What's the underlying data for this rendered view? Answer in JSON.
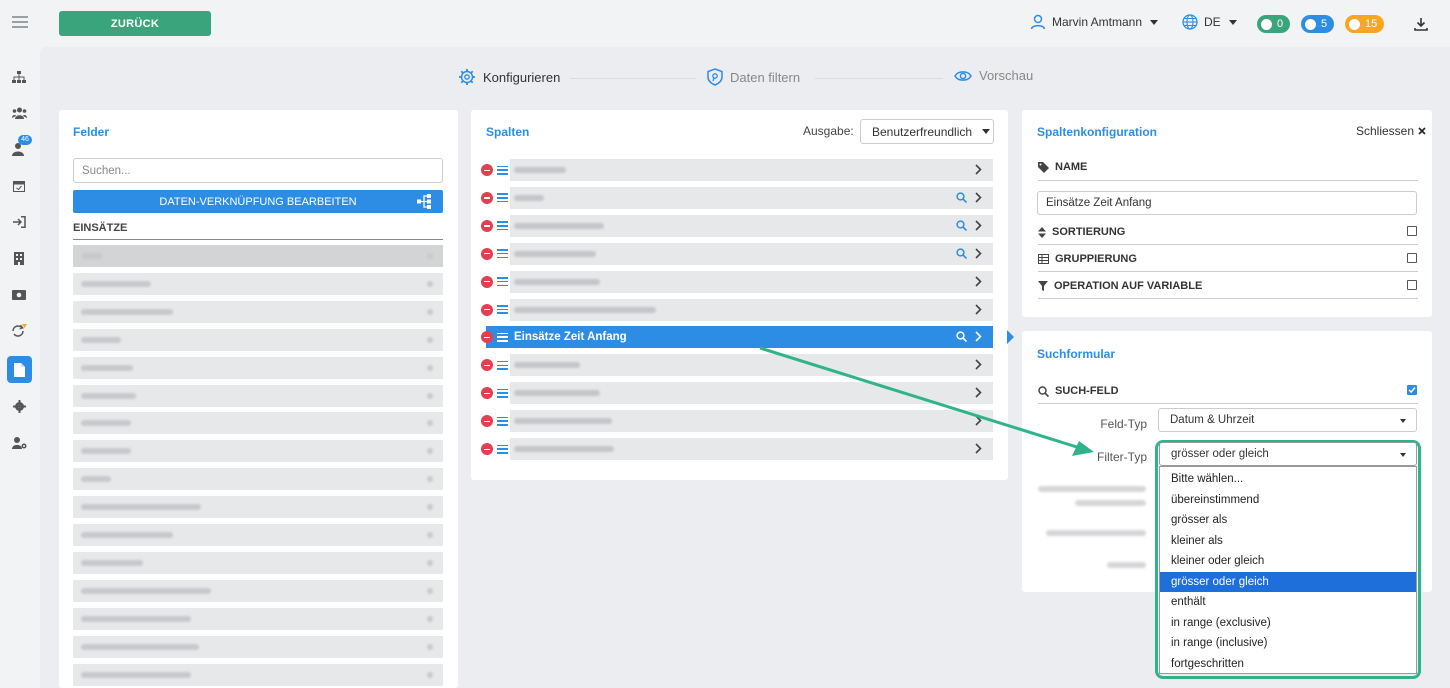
{
  "header": {
    "back_label": "ZURÜCK",
    "user_name": "Marvin Amtmann",
    "language": "DE",
    "badges": {
      "messages": "0",
      "notifications": "5",
      "warnings": "15"
    }
  },
  "sidebar": {
    "badge_count": "46"
  },
  "stepper": {
    "step1": "Konfigurieren",
    "step2": "Daten filtern",
    "step3": "Vorschau"
  },
  "felder": {
    "title": "Felder",
    "search_placeholder": "Suchen...",
    "edit_link_button": "DATEN-VERKNÜPFUNG BEARBEITEN",
    "section_label": "EINSÄTZE"
  },
  "spalten": {
    "title": "Spalten",
    "output_label": "Ausgabe:",
    "output_value": "Benutzerfreundlich",
    "active_column": "Einsätze Zeit Anfang"
  },
  "config": {
    "title": "Spaltenkonfiguration",
    "close_label": "Schliessen",
    "name_label": "NAME",
    "name_value": "Einsätze Zeit Anfang",
    "sort_label": "SORTIERUNG",
    "group_label": "GRUPPIERUNG",
    "operation_label": "OPERATION AUF VARIABLE"
  },
  "search_form": {
    "title": "Suchformular",
    "search_field_label": "SUCH-FELD",
    "field_type_label": "Feld-Typ",
    "field_type_value": "Datum & Uhrzeit",
    "filter_type_label": "Filter-Typ",
    "filter_type_value": "grösser oder gleich",
    "filter_options": [
      "Bitte wählen...",
      "übereinstimmend",
      "grösser als",
      "kleiner als",
      "kleiner oder gleich",
      "grösser oder gleich",
      "enthält",
      "in range (exclusive)",
      "in range (inclusive)",
      "fortgeschritten"
    ],
    "selected_option_index": 5
  },
  "colors": {
    "primary": "#2d8de4",
    "success": "#3aa57d",
    "warning": "#f6a623",
    "danger": "#e04050",
    "highlight": "#2fb48a"
  }
}
